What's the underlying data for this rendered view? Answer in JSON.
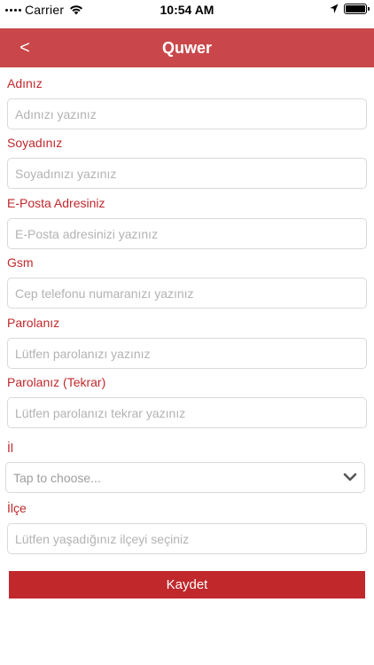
{
  "status_bar": {
    "carrier": "Carrier",
    "time": "10:54 AM",
    "icons": [
      "signal-icon",
      "wifi-icon",
      "location-icon",
      "battery-icon"
    ]
  },
  "nav": {
    "back_label": "<",
    "title": "Quwer",
    "color": "#c9474a"
  },
  "form": {
    "name": {
      "label": "Adınız",
      "placeholder": "Adınızı yazınız"
    },
    "surname": {
      "label": "Soyadınız",
      "placeholder": "Soyadınızı yazınız"
    },
    "email": {
      "label": "E-Posta Adresiniz",
      "placeholder": "E-Posta adresinizi yazınız"
    },
    "gsm": {
      "label": "Gsm",
      "placeholder": "Cep telefonu numaranızı yazınız"
    },
    "password": {
      "label": "Parolanız",
      "placeholder": "Lütfen parolanızı yazınız"
    },
    "password_repeat": {
      "label": "Parolanız (Tekrar)",
      "placeholder": "Lütfen parolanızı tekrar yazınız"
    },
    "city": {
      "label": "İl",
      "value": "Tap to choose..."
    },
    "district": {
      "label": "İlçe",
      "placeholder": "Lütfen yaşadığınız ilçeyi seçiniz"
    },
    "save_label": "Kaydet"
  },
  "colors": {
    "accent": "#c0282c",
    "label": "#c0282c",
    "border": "#d9d9d9",
    "placeholder": "#b3b3b3"
  }
}
